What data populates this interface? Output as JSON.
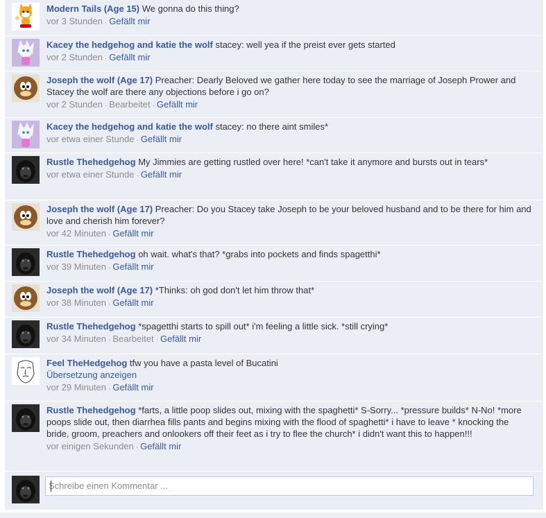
{
  "comments": [
    {
      "author": "Modern Tails (Age 15)",
      "text": "We gonna do this thing?",
      "time": "vor 3 Stunden",
      "edited": "",
      "like": "Gefällt mir",
      "avatar": "fox-cartoon"
    },
    {
      "author": "Kacey the hedgehog and katie the wolf",
      "text": "stacey: well yea if the preist ever gets started",
      "time": "vor 2 Stunden",
      "edited": "",
      "like": "Gefällt mir",
      "avatar": "white-hedgehog"
    },
    {
      "author": "Joseph the wolf (Age 17)",
      "text": "Preacher: Dearly Beloved we gather here today to see the marriage of Joseph Prower and Stacey the wolf are there any objections before i go on?",
      "time": "vor 2 Stunden",
      "edited": "Bearbeitet",
      "like": "Gefällt mir",
      "avatar": "brown-character"
    },
    {
      "author": "Kacey the hedgehog and katie the wolf",
      "text": "stacey: no there aint smiles*",
      "time": "vor etwa einer Stunde",
      "edited": "",
      "like": "Gefällt mir",
      "avatar": "white-hedgehog"
    },
    {
      "author": "Rustle Thehedgehog",
      "text": "My Jimmies are getting rustled over here! *can't take it anymore and bursts out in tears*",
      "time": "vor etwa einer Stunde",
      "edited": "",
      "like": "Gefällt mir",
      "avatar": "gorilla"
    },
    {
      "author": "Joseph the wolf (Age 17)",
      "text": "Preacher: Do you Stacey take Joseph to be your beloved husband and to be there for him and love and cherish him forever?",
      "time": "vor 42 Minuten",
      "edited": "",
      "like": "Gefällt mir",
      "avatar": "brown-character"
    },
    {
      "author": "Rustle Thehedgehog",
      "text": "oh wait. what's that? *grabs into pockets and finds spagetthi*",
      "time": "vor 39 Minuten",
      "edited": "",
      "like": "Gefällt mir",
      "avatar": "gorilla"
    },
    {
      "author": "Joseph the wolf (Age 17)",
      "text": "*Thinks: oh god don't let him throw that*",
      "time": "vor 38 Minuten",
      "edited": "",
      "like": "Gefällt mir",
      "avatar": "brown-character"
    },
    {
      "author": "Rustle Thehedgehog",
      "text": "*spagetthi starts to spill out* i'm feeling a little sick. *still crying*",
      "time": "vor 34 Minuten",
      "edited": "Bearbeitet",
      "like": "Gefällt mir",
      "avatar": "gorilla"
    },
    {
      "author": "Feel TheHedgehog",
      "text": "tfw you have a pasta level of Bucatini",
      "translate": "Übersetzung anzeigen",
      "time": "vor 29 Minuten",
      "edited": "",
      "like": "Gefällt mir",
      "avatar": "feels-guy"
    },
    {
      "author": "Rustle Thehedgehog",
      "text": "*farts, a little poop slides out, mixing with the spaghetti* S-Sorry... *pressure builds* N-No! *more poops slide out, then diarrhea fills pants and begins mixing with the flood of spaghetti* i have to leave * knocking the bride, groom, preachers and onlookers off their feet as i try to flee the church* i didn't want this to happen!!!",
      "time": "vor einigen Sekunden",
      "edited": "",
      "like": "Gefällt mir",
      "avatar": "gorilla"
    }
  ],
  "composer": {
    "placeholder": "Schreibe einen Kommentar ...",
    "avatar": "gorilla"
  },
  "colors": {
    "link": "#3b5998",
    "panel": "#eceef5",
    "meta": "#8c8c8c"
  }
}
